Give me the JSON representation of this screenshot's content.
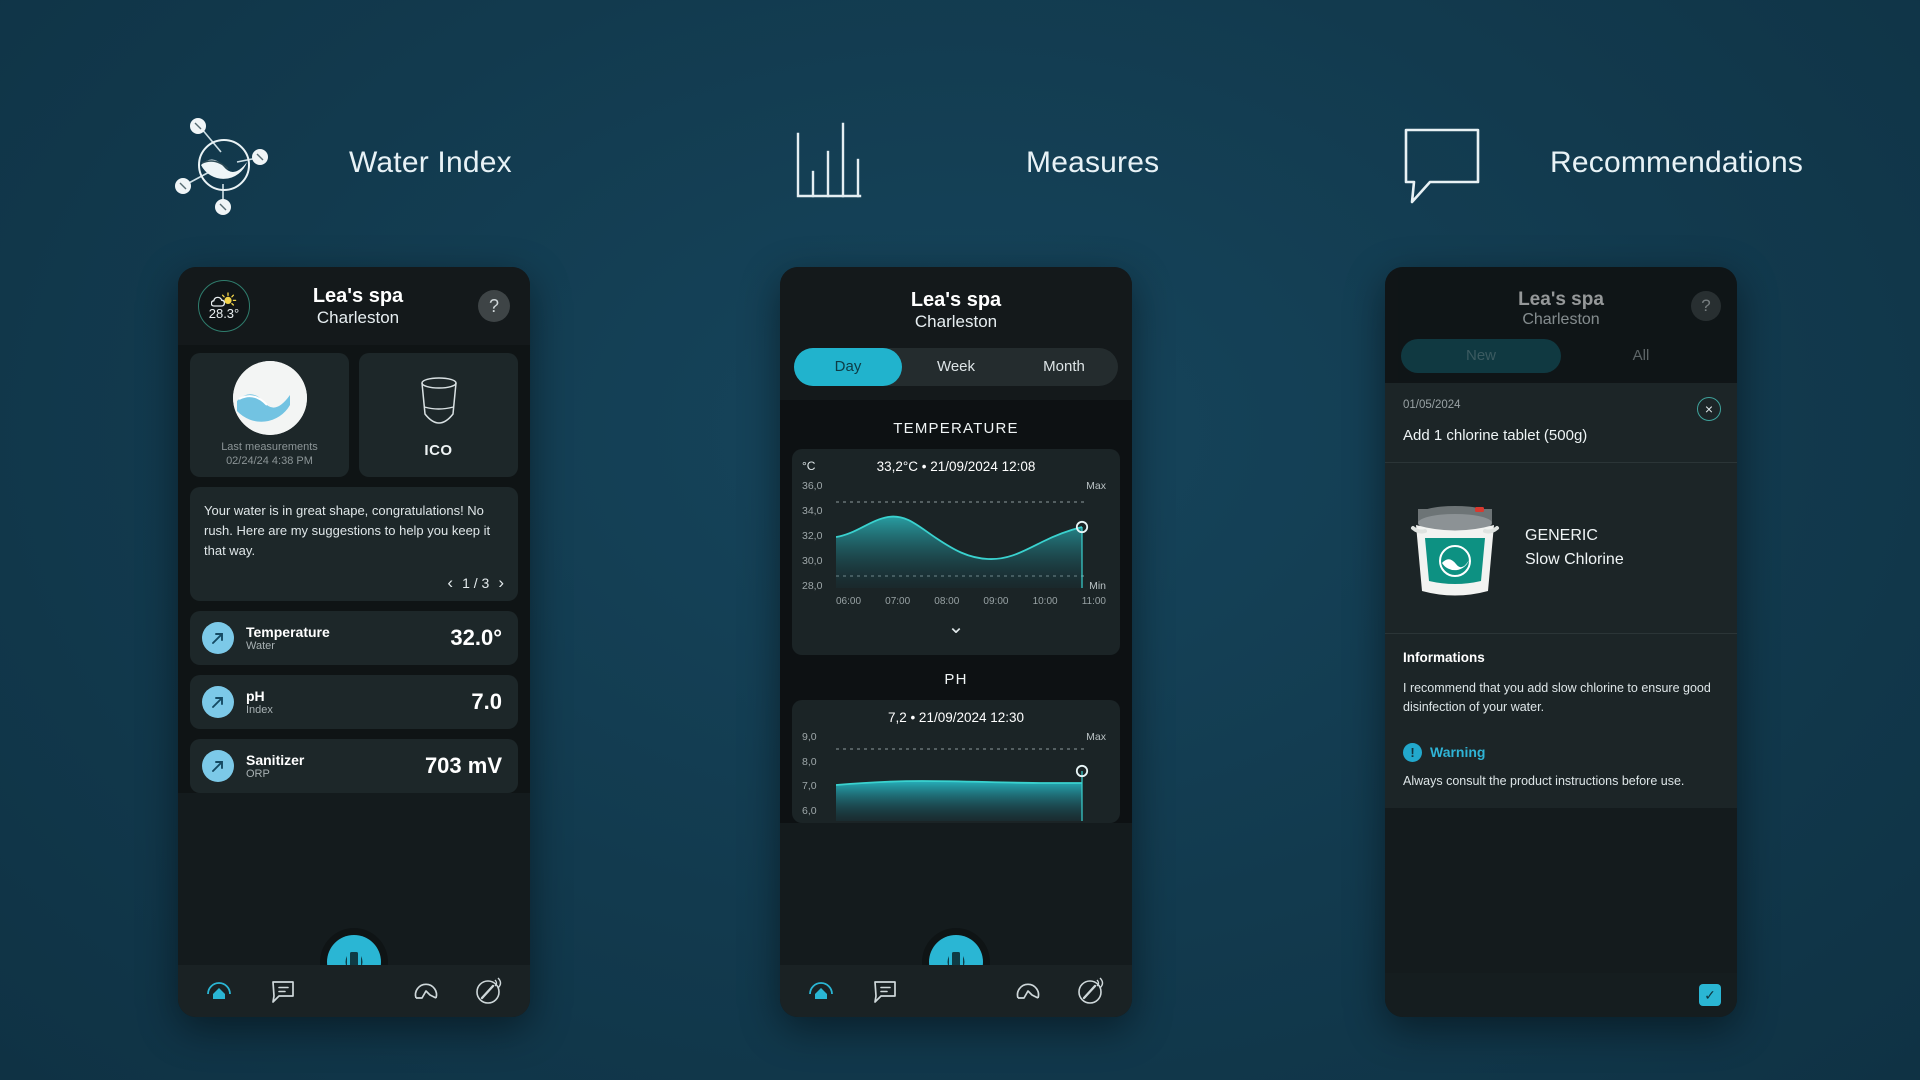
{
  "sections": [
    {
      "icon": "water-molecule-icon",
      "label": "Water Index"
    },
    {
      "icon": "bar-chart-icon",
      "label": "Measures"
    },
    {
      "icon": "speech-bubble-icon",
      "label": "Recommendations"
    }
  ],
  "colors": {
    "page_bg": "#123a4e",
    "accent_cyan": "#2ab6d4",
    "accent_light_blue": "#7cc9e8",
    "card_bg": "#1d2729",
    "phone_bg": "#0f1415",
    "warning": "#2fb4d6"
  },
  "water_index": {
    "weather": {
      "temp": "28.3°",
      "icon": "sun-cloud-icon"
    },
    "title": "Lea's spa",
    "subtitle": "Charleston",
    "help_label": "?",
    "tiles": [
      {
        "icon": "water-drop-circle-icon",
        "caption_line1": "Last measurements",
        "caption_line2": "02/24/24 4:38 PM"
      },
      {
        "icon": "ico-device-icon",
        "label": "ICO"
      }
    ],
    "advice": {
      "text": "Your water is in great shape, congratulations! No rush. Here are my suggestions to help you keep it that way.",
      "prev_arrow": "‹",
      "page_indicator": "1 / 3",
      "next_arrow": "›"
    },
    "metrics": [
      {
        "name": "Temperature",
        "sub": "Water",
        "value": "32.0°",
        "icon": "trend-arrow-icon"
      },
      {
        "name": "pH",
        "sub": "Index",
        "value": "7.0",
        "icon": "trend-arrow-icon"
      },
      {
        "name": "Sanitizer",
        "sub": "ORP",
        "value": "703 mV",
        "icon": "trend-arrow-icon"
      }
    ],
    "nav": [
      {
        "icon": "home-icon",
        "active": true
      },
      {
        "icon": "chat-icon",
        "active": false
      },
      {
        "icon": "ico-device-icon",
        "active": true
      },
      {
        "icon": "gauge-icon",
        "active": false
      },
      {
        "icon": "test-strip-icon",
        "active": false
      }
    ]
  },
  "measures": {
    "title": "Lea's spa",
    "subtitle": "Charleston",
    "segments": [
      {
        "label": "Day",
        "active": true
      },
      {
        "label": "Week",
        "active": false
      },
      {
        "label": "Month",
        "active": false
      }
    ],
    "chevron": "⌄",
    "nav": [
      {
        "icon": "home-icon",
        "active": true
      },
      {
        "icon": "chat-icon",
        "active": false
      },
      {
        "icon": "ico-device-icon",
        "active": true
      },
      {
        "icon": "gauge-icon",
        "active": false
      },
      {
        "icon": "test-strip-icon",
        "active": false
      }
    ]
  },
  "recommendations": {
    "title": "Lea's spa",
    "subtitle": "Charleston",
    "help_label": "?",
    "segments": [
      {
        "label": "New",
        "active": true
      },
      {
        "label": "All",
        "active": false
      }
    ],
    "card": {
      "date": "01/05/2024",
      "close_label": "×",
      "text": "Add 1 chlorine tablet (500g)"
    },
    "product": {
      "brand": "GENERIC",
      "name": "Slow Chlorine",
      "icon": "chlorine-bucket-icon"
    },
    "informations": {
      "title": "Informations",
      "text": "I recommend that you add slow chlorine to ensure good disinfection of your water.",
      "warning_icon": "!",
      "warning_label": "Warning",
      "warning_text": "Always consult the product instructions before use."
    },
    "confirm_check": "✓"
  },
  "chart_data": [
    {
      "type": "area",
      "title": "TEMPERATURE",
      "header": "33,2°C • 21/09/2024 12:08",
      "ylabel": "°C",
      "yticks": [
        "36,0",
        "34,0",
        "32,0",
        "30,0",
        "28,0"
      ],
      "ylim": [
        28.0,
        36.0
      ],
      "xticks": [
        "06:00",
        "07:00",
        "08:00",
        "09:00",
        "10:00",
        "11:00"
      ],
      "max_line_label": "Max",
      "min_line_label": "Min",
      "max_line_value": 35.2,
      "min_line_value": 29.3,
      "x": [
        5.6,
        6.0,
        6.5,
        7.0,
        7.5,
        8.0,
        8.5,
        9.0,
        9.5,
        10.0,
        10.5,
        11.0,
        11.4
      ],
      "values": [
        32.4,
        32.8,
        33.5,
        34.0,
        33.9,
        33.2,
        32.2,
        31.4,
        31.0,
        30.9,
        31.2,
        32.0,
        33.2
      ],
      "last_point": {
        "x": 11.4,
        "y": 33.2
      },
      "grid": false,
      "line_color": "#34d0d4"
    },
    {
      "type": "area",
      "title": "PH",
      "header": "7,2 • 21/09/2024 12:30",
      "ylabel": "",
      "yticks": [
        "9,0",
        "8,0",
        "7,0",
        "6,0"
      ],
      "ylim": [
        6.0,
        9.0
      ],
      "xticks": [],
      "max_line_label": "Max",
      "max_line_value": 8.8,
      "x": [
        5.6,
        6.5,
        7.5,
        8.5,
        9.5,
        10.5,
        11.4
      ],
      "values": [
        7.0,
        7.1,
        7.15,
        7.1,
        7.05,
        7.05,
        7.2
      ],
      "last_point": {
        "x": 11.4,
        "y": 7.5
      },
      "grid": false,
      "line_color": "#34d0d4"
    }
  ]
}
